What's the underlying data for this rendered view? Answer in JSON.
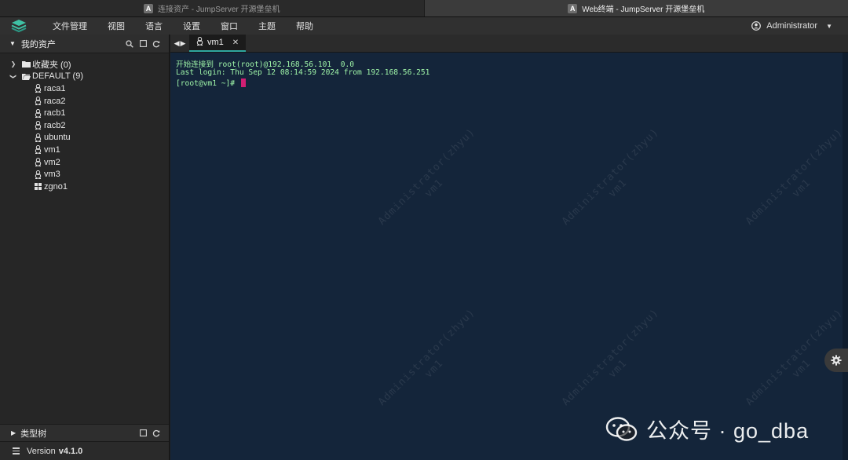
{
  "browser": {
    "tabs": [
      {
        "favicon": "A",
        "title": "连接资产 - JumpServer 开源堡垒机",
        "active": false
      },
      {
        "favicon": "A",
        "title": "Web终端 - JumpServer 开源堡垒机",
        "active": true
      }
    ]
  },
  "menubar": {
    "items": [
      "文件管理",
      "视图",
      "语言",
      "设置",
      "窗口",
      "主题",
      "帮助"
    ],
    "user": "Administrator"
  },
  "sidebar": {
    "title": "我的资产",
    "folders": [
      {
        "label": "收藏夹 (0)",
        "expanded": false
      },
      {
        "label": "DEFAULT (9)",
        "expanded": true
      }
    ],
    "assets": [
      {
        "name": "raca1",
        "os": "linux-icon"
      },
      {
        "name": "raca2",
        "os": "linux-icon"
      },
      {
        "name": "racb1",
        "os": "linux-icon"
      },
      {
        "name": "racb2",
        "os": "linux-icon"
      },
      {
        "name": "ubuntu",
        "os": "linux-icon"
      },
      {
        "name": "vm1",
        "os": "linux-icon"
      },
      {
        "name": "vm2",
        "os": "linux-icon"
      },
      {
        "name": "vm3",
        "os": "linux-icon"
      },
      {
        "name": "zgno1",
        "os": "windows-icon"
      }
    ],
    "type_tree": "类型树",
    "version_label": "Version",
    "version": "v4.1.0"
  },
  "terminal": {
    "tab_label": "vm1",
    "lines": [
      "开始连接到 root(root)@192.168.56.101  0.0",
      "Last login: Thu Sep 12 08:14:59 2024 from 192.168.56.251",
      "[root@vm1 ~]# "
    ],
    "watermark": {
      "user": "Administrator(zhyu)",
      "asset": "vm1"
    }
  },
  "overlay": {
    "wechat_text": "公众号 · go_dba"
  },
  "colors": {
    "terminal_bg": "#14253a",
    "terminal_text": "#9ff5a8",
    "cursor": "#d11f73",
    "accent": "#2fa7a0"
  }
}
